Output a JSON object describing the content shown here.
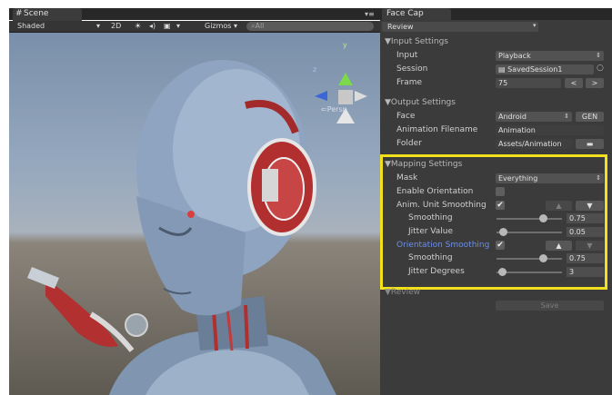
{
  "scene": {
    "tab": "Scene",
    "shading": "Shaded",
    "mode_2d": "2D",
    "gizmos": "Gizmos",
    "search_placeholder": "All",
    "persp": "Persp",
    "gizmo_axes": {
      "y": "y",
      "z": "z"
    }
  },
  "inspector": {
    "tab": "Face Cap",
    "review_select": "Review",
    "input_settings": {
      "title": "Input Settings",
      "input_label": "Input",
      "input_value": "Playback",
      "session_label": "Session",
      "session_value": "SavedSession1",
      "frame_label": "Frame",
      "frame_value": "75"
    },
    "output_settings": {
      "title": "Output Settings",
      "face_label": "Face",
      "face_value": "Android",
      "gen_button": "GEN",
      "anim_filename_label": "Animation Filename",
      "anim_filename_value": "Animation",
      "folder_label": "Folder",
      "folder_value": "Assets/Animation"
    },
    "mapping_settings": {
      "title": "Mapping Settings",
      "mask_label": "Mask",
      "mask_value": "Everything",
      "enable_orientation_label": "Enable Orientation",
      "enable_orientation": false,
      "anim_unit_smoothing_label": "Anim. Unit Smoothing",
      "anim_unit_smoothing": true,
      "smoothing_label": "Smoothing",
      "smoothing_value": "0.75",
      "smoothing_fraction": 0.75,
      "jitter_value_label": "Jitter Value",
      "jitter_value": "0.05",
      "jitter_fraction": 0.05,
      "orientation_smoothing_label": "Orientation Smoothing",
      "orientation_smoothing": true,
      "orient_smoothing_label": "Smoothing",
      "orient_smoothing_value": "0.75",
      "orient_smoothing_fraction": 0.75,
      "jitter_degrees_label": "Jitter Degrees",
      "jitter_degrees_value": "3",
      "jitter_degrees_fraction": 0.03
    },
    "review": {
      "title": "Review",
      "save_button": "Save"
    }
  },
  "colors": {
    "highlight": "#f2e01c",
    "orientation_label": "#6b8ee8"
  }
}
